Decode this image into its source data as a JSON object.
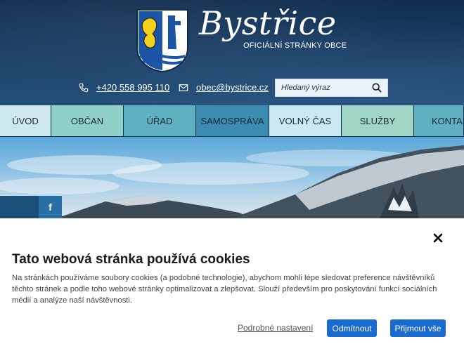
{
  "header": {
    "brand_name": "Bystřice",
    "brand_subtitle": "OFICIÁLNÍ STRÁNKY OBCE",
    "phone": "+420 558 995 110",
    "email": "obec@bystrice.cz",
    "search_placeholder": "Hledaný výraz",
    "icons": {
      "phone": "phone-icon",
      "email": "envelope-icon",
      "search": "search-icon",
      "crest": "coat-of-arms"
    }
  },
  "nav": {
    "items": [
      {
        "label": "ÚVOD"
      },
      {
        "label": "OBČAN"
      },
      {
        "label": "ÚŘAD"
      },
      {
        "label": "SAMOSPRÁVA"
      },
      {
        "label": "VOLNÝ ČAS"
      },
      {
        "label": "SLUŽBY"
      },
      {
        "label": "KONTAKT"
      }
    ]
  },
  "hero": {
    "facebook_glyph": "f"
  },
  "cookie": {
    "title": "Tato webová stránka používá cookies",
    "text": "Na stránkách používáme soubory cookies (a podobné technologie), abychom mohli lépe sledovat preference návštěvníků těchto stránek a podle toho webové stránky optimalizovat a zlepšovat. Slouží především pro poskytování funkcí sociálních médií a analýze naší návštěvnosti.",
    "settings_label": "Podrobné nastavení",
    "reject_label": "Odmítnout",
    "accept_label": "Přijmout vše",
    "close_icon": "close-icon"
  },
  "colors": {
    "header_bg": "#1a3d63",
    "button_primary": "#1a6bd0",
    "nav_colors": [
      "#cde9ee",
      "#8fd0c9",
      "#5fb0c1",
      "#3c8bb0",
      "#cbe8f5",
      "#9fd6c6",
      "#5fb0c1"
    ]
  }
}
